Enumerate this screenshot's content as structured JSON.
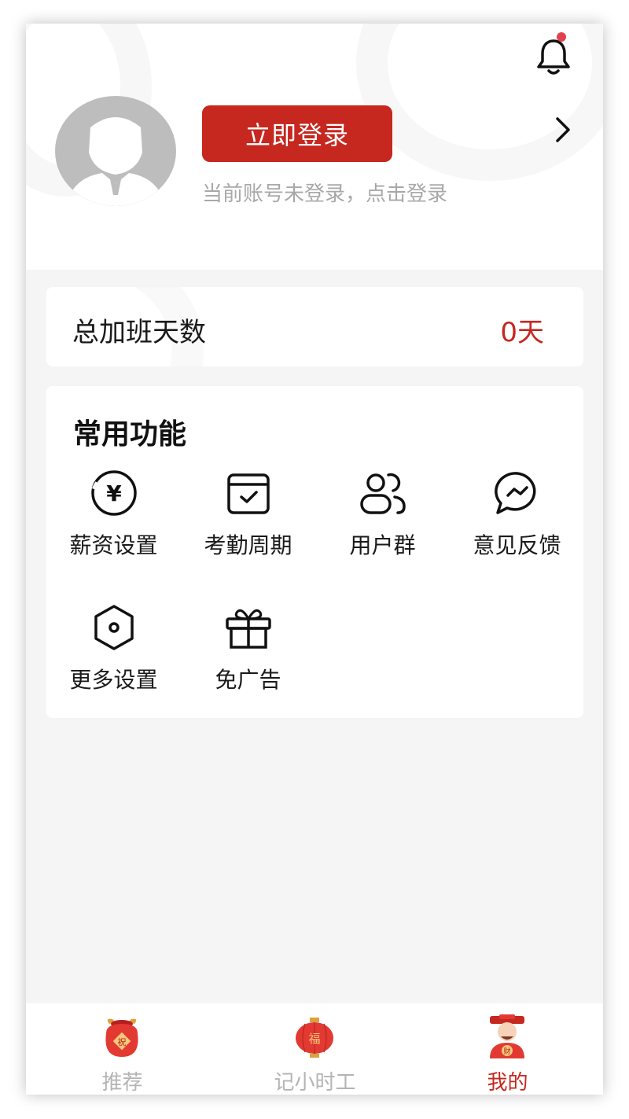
{
  "header": {
    "login_button": "立即登录",
    "login_hint": "当前账号未登录，点击登录",
    "notification_unread": true
  },
  "overtime": {
    "label": "总加班天数",
    "value": "0天"
  },
  "functions": {
    "title": "常用功能",
    "items": [
      {
        "label": "薪资设置",
        "icon": "yen-coin-icon"
      },
      {
        "label": "考勤周期",
        "icon": "calendar-check-icon"
      },
      {
        "label": "用户群",
        "icon": "users-group-icon"
      },
      {
        "label": "意见反馈",
        "icon": "chat-feedback-icon"
      },
      {
        "label": "更多设置",
        "icon": "hexagon-settings-icon"
      },
      {
        "label": "免广告",
        "icon": "gift-icon"
      }
    ]
  },
  "tabbar": {
    "tabs": [
      {
        "label": "推荐",
        "icon": "lucky-bag-icon",
        "active": false
      },
      {
        "label": "记小时工",
        "icon": "lantern-icon",
        "active": false
      },
      {
        "label": "我的",
        "icon": "fortune-god-icon",
        "active": true
      }
    ]
  },
  "colors": {
    "accent": "#c6271f",
    "background": "#f5f5f5",
    "muted_text": "#a8a8a8",
    "tab_inactive": "#b4b4b4"
  },
  "icon_glyphs": {
    "yen": "¥",
    "fu": "福",
    "cai": "财",
    "zhu": "祝"
  }
}
